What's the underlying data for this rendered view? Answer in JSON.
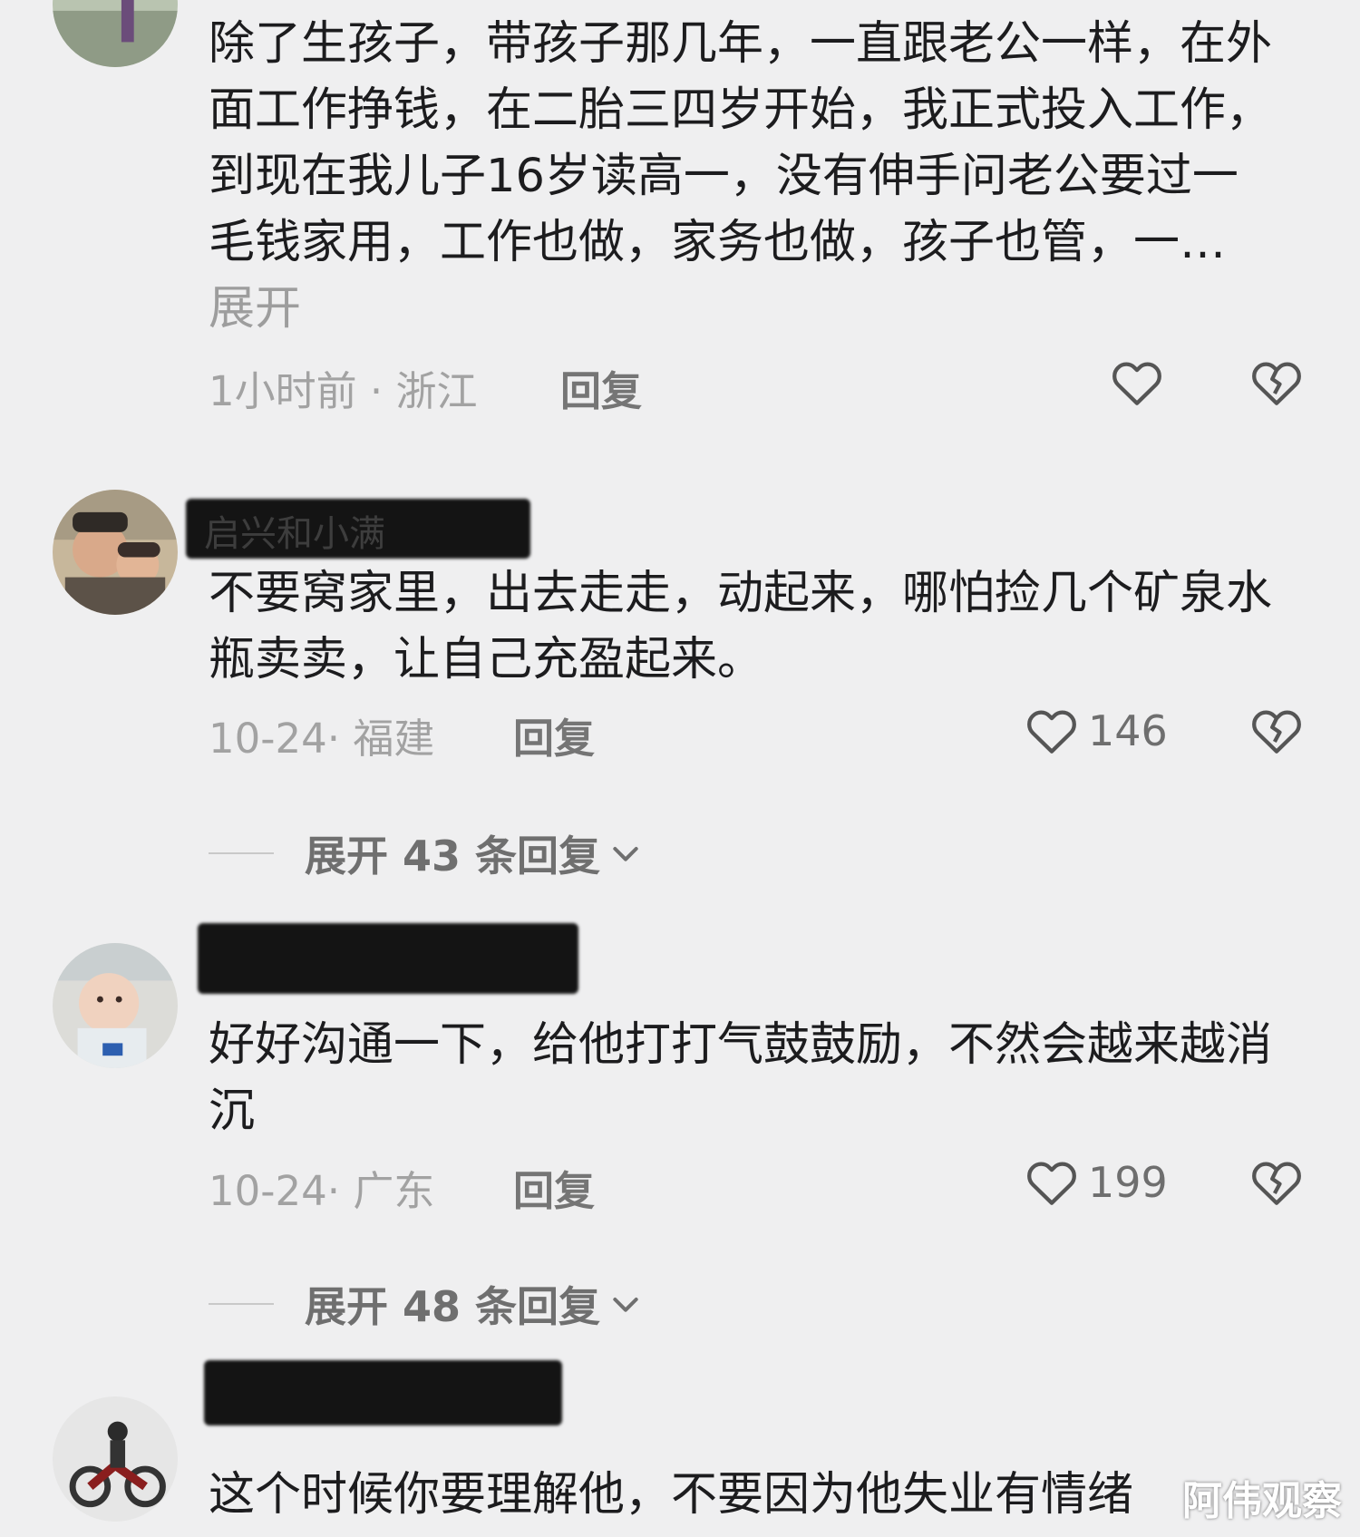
{
  "comments": [
    {
      "body": "除了生孩子，带孩子那几年，一直跟老公一样，在外面工作挣钱，在二胎三四岁开始，我正式投入工作，到现在我儿子16岁读高一，没有伸手问老公要过一毛钱家用，工作也做，家务也做，孩子也管，一…",
      "more": " 展开",
      "meta": "1小时前 · 浙江",
      "reply": "回复",
      "likes": ""
    },
    {
      "username": "启兴和小满",
      "body": "不要窝家里，出去走走，动起来，哪怕捡几个矿泉水瓶卖卖，让自己充盈起来。",
      "meta": "10-24· 福建",
      "reply": "回复",
      "likes": "146",
      "expand": "展开 43 条回复"
    },
    {
      "body": "好好沟通一下，给他打打气鼓鼓励，不然会越来越消沉",
      "meta": "10-24· 广东",
      "reply": "回复",
      "likes": "199",
      "expand": "展开 48 条回复"
    },
    {
      "body": "这个时候你要理解他，不要因为他失业有情绪"
    }
  ],
  "watermark": "阿伟观察",
  "icons": {
    "like": "heart-outline-icon",
    "dislike": "broken-heart-icon",
    "expand": "chevron-down-icon"
  },
  "colors": {
    "background": "#efeff0",
    "text": "#1c1c1e",
    "meta": "#a2a2a2"
  }
}
